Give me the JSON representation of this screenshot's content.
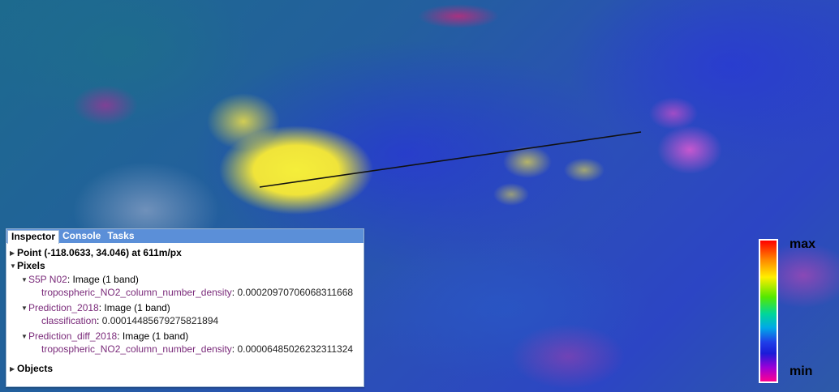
{
  "map": {
    "colors": {
      "high": "#f0e43a",
      "mid": "#2b4fb8",
      "low": "#d25fc8",
      "background": "#1d6a8e"
    }
  },
  "legend": {
    "max_label": "max",
    "min_label": "min",
    "palette": [
      "#ff0000",
      "#ff8a00",
      "#ffee00",
      "#55e800",
      "#00d69a",
      "#00a8e8",
      "#1f3fe8",
      "#1b1bd8",
      "#9a00d8",
      "#ff0090"
    ]
  },
  "inspector": {
    "tabs": [
      {
        "label": "Inspector",
        "active": true
      },
      {
        "label": "Console",
        "active": false
      },
      {
        "label": "Tasks",
        "active": false
      }
    ],
    "point_line": "Point (-118.0633, 34.046) at 611m/px",
    "pixels_header": "Pixels",
    "layers": [
      {
        "name": "S5P N02",
        "type": ": Image (1 band)",
        "band": "tropospheric_NO2_column_number_density",
        "value": "0.00020970706068311668"
      },
      {
        "name": "Prediction_2018",
        "type": ": Image (1 band)",
        "band": "classification",
        "value": "0.00014485679275821894"
      },
      {
        "name": "Prediction_diff_2018",
        "type": ": Image (1 band)",
        "band": "tropospheric_NO2_column_number_density",
        "value": "0.00006485026232311324"
      }
    ],
    "objects_header": "Objects"
  }
}
